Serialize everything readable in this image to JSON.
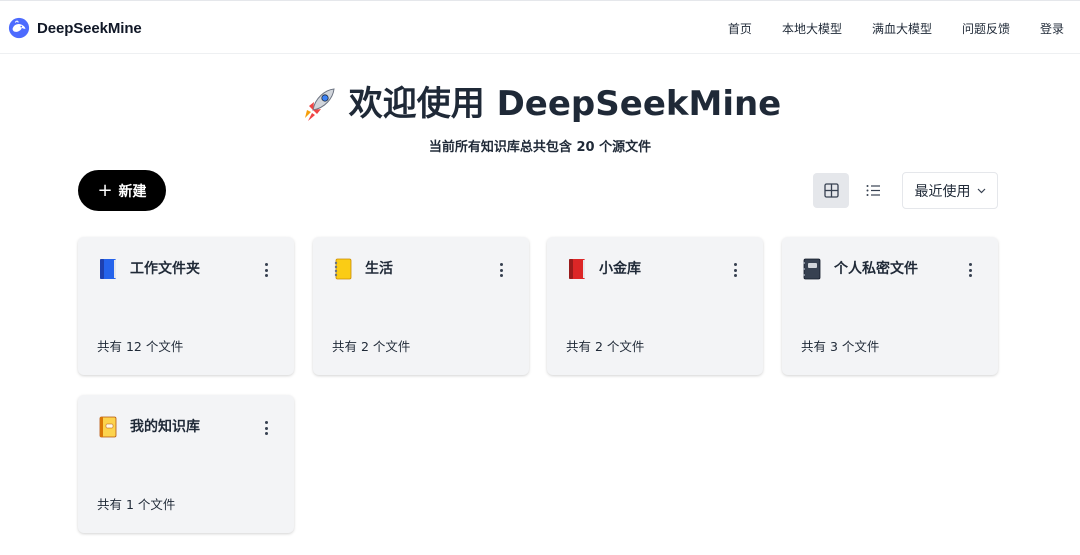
{
  "brand": {
    "name": "DeepSeekMine"
  },
  "nav": {
    "items": [
      "首页",
      "本地大模型",
      "满血大模型",
      "问题反馈",
      "登录"
    ]
  },
  "hero": {
    "title": "欢迎使用 DeepSeekMine",
    "title_icon": "rocket-icon",
    "subtitle": "当前所有知识库总共包含 20 个源文件"
  },
  "toolbar": {
    "new_label": "新建",
    "sort_label": "最近使用",
    "active_view": "grid"
  },
  "colors": {
    "primary_button": "#000000",
    "card_background": "#f3f4f6",
    "text": "#1f2937"
  },
  "libraries": [
    {
      "name": "工作文件夹",
      "icon": "blue-book-icon",
      "count": "共有 12 个文件"
    },
    {
      "name": "生活",
      "icon": "yellow-notebook-icon",
      "count": "共有 2 个文件"
    },
    {
      "name": "小金库",
      "icon": "red-book-icon",
      "count": "共有 2 个文件"
    },
    {
      "name": "个人私密文件",
      "icon": "black-notebook-icon",
      "count": "共有 3 个文件"
    },
    {
      "name": "我的知识库",
      "icon": "ledger-icon",
      "count": "共有 1 个文件"
    }
  ]
}
